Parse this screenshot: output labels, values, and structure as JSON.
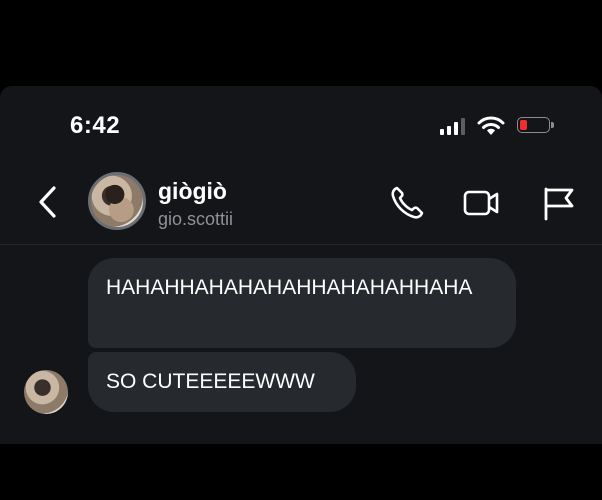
{
  "status_bar": {
    "time": "6:42",
    "icons": [
      "cellular-signal-icon",
      "wifi-icon",
      "battery-low-icon"
    ],
    "battery_color": "#ef2d2d"
  },
  "header": {
    "contact_name": "giògiò",
    "contact_handle": "gio.scottii",
    "icons": [
      "back-chevron-icon",
      "phone-icon",
      "video-camera-icon",
      "flag-icon"
    ]
  },
  "messages": [
    {
      "sender": "incoming",
      "text": "HAHAHHAHAHAHAHHAHAHAHHAHA"
    },
    {
      "sender": "incoming",
      "text": "SO CUTEEEEEWWW"
    }
  ],
  "colors": {
    "background": "#131518",
    "bubble": "#26292e",
    "secondary_text": "#8e9196"
  }
}
